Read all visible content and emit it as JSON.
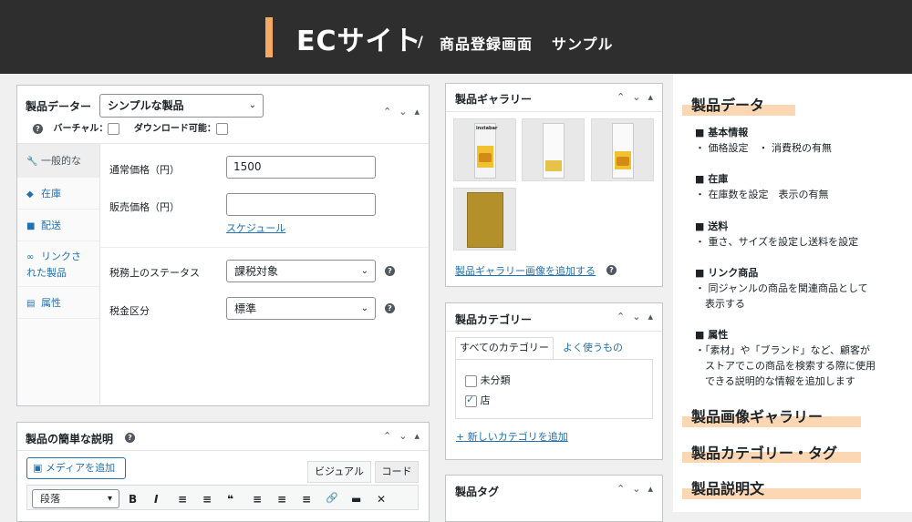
{
  "header": {
    "title": "ECサイト",
    "slash": "/",
    "subtitle": "商品登録画面",
    "subtitle2": "サンプル"
  },
  "product_data": {
    "label": "製品データー",
    "type_select": "シンプルな製品",
    "virtual_label": "バーチャル：",
    "download_label": "ダウンロード可能：",
    "tabs": [
      {
        "label": "一般的な",
        "icon": "wrench-icon"
      },
      {
        "label": "在庫",
        "icon": "tag-icon"
      },
      {
        "label": "配送",
        "icon": "truck-icon"
      },
      {
        "label": "リンクさ",
        "label2": "れた製品",
        "icon": "link-icon"
      },
      {
        "label": "属性",
        "icon": "list-icon"
      }
    ],
    "regular_price_label": "通常価格（円）",
    "regular_price_value": "1500",
    "sale_price_label": "販売価格（円）",
    "sale_price_value": "",
    "schedule_link": "スケジュール",
    "tax_status_label": "税務上のステータス",
    "tax_status_value": "課税対象",
    "tax_class_label": "税金区分",
    "tax_class_value": "標準"
  },
  "short_description": {
    "title": "製品の簡単な説明",
    "add_media": "メディアを追加",
    "tab_visual": "ビジュアル",
    "tab_code": "コード",
    "format_select": "段落",
    "toolbar": [
      "B",
      "I",
      "≡",
      "≡",
      "❝",
      "≡",
      "≡",
      "≡",
      "🔗",
      "▬",
      "✕"
    ]
  },
  "gallery": {
    "title": "製品ギャラリー",
    "add_link": "製品ギャラリー画像を追加する",
    "thumb_text": "instabar"
  },
  "categories": {
    "title": "製品カテゴリー",
    "tab_all": "すべてのカテゴリー",
    "tab_popular": "よく使うもの",
    "items": [
      {
        "label": "未分類",
        "checked": false
      },
      {
        "label": "店",
        "checked": true
      }
    ],
    "add_new": "+ 新しいカテゴリを追加"
  },
  "tags": {
    "title": "製品タグ"
  },
  "side": {
    "heading1": "製品データ",
    "sections": [
      {
        "title": "■ 基本情報",
        "lines": [
          "・ 価格設定　・ 消費税の有無"
        ]
      },
      {
        "title": "■ 在庫",
        "lines": [
          "・ 在庫数を設定　表示の有無"
        ]
      },
      {
        "title": "■ 送料",
        "lines": [
          "・ 重さ、サイズを設定し送料を設定"
        ]
      },
      {
        "title": "■ リンク商品",
        "lines": [
          "・ 同ジャンルの商品を関連商品として",
          "　表示する"
        ]
      },
      {
        "title": "■ 属性",
        "lines": [
          "・「素材」や「ブランド」など、顧客が",
          "　ストアでこの商品を検索する際に使用",
          "　できる説明的な情報を追加します"
        ]
      }
    ],
    "heading2": "製品画像ギャラリー",
    "heading3": "製品カテゴリー・タグ",
    "heading4": "製品説明文"
  },
  "colors": {
    "header_bg": "#2e2e2e",
    "accent": "#f6a961",
    "highlight": "#fbd7b4",
    "link": "#2271b1"
  }
}
